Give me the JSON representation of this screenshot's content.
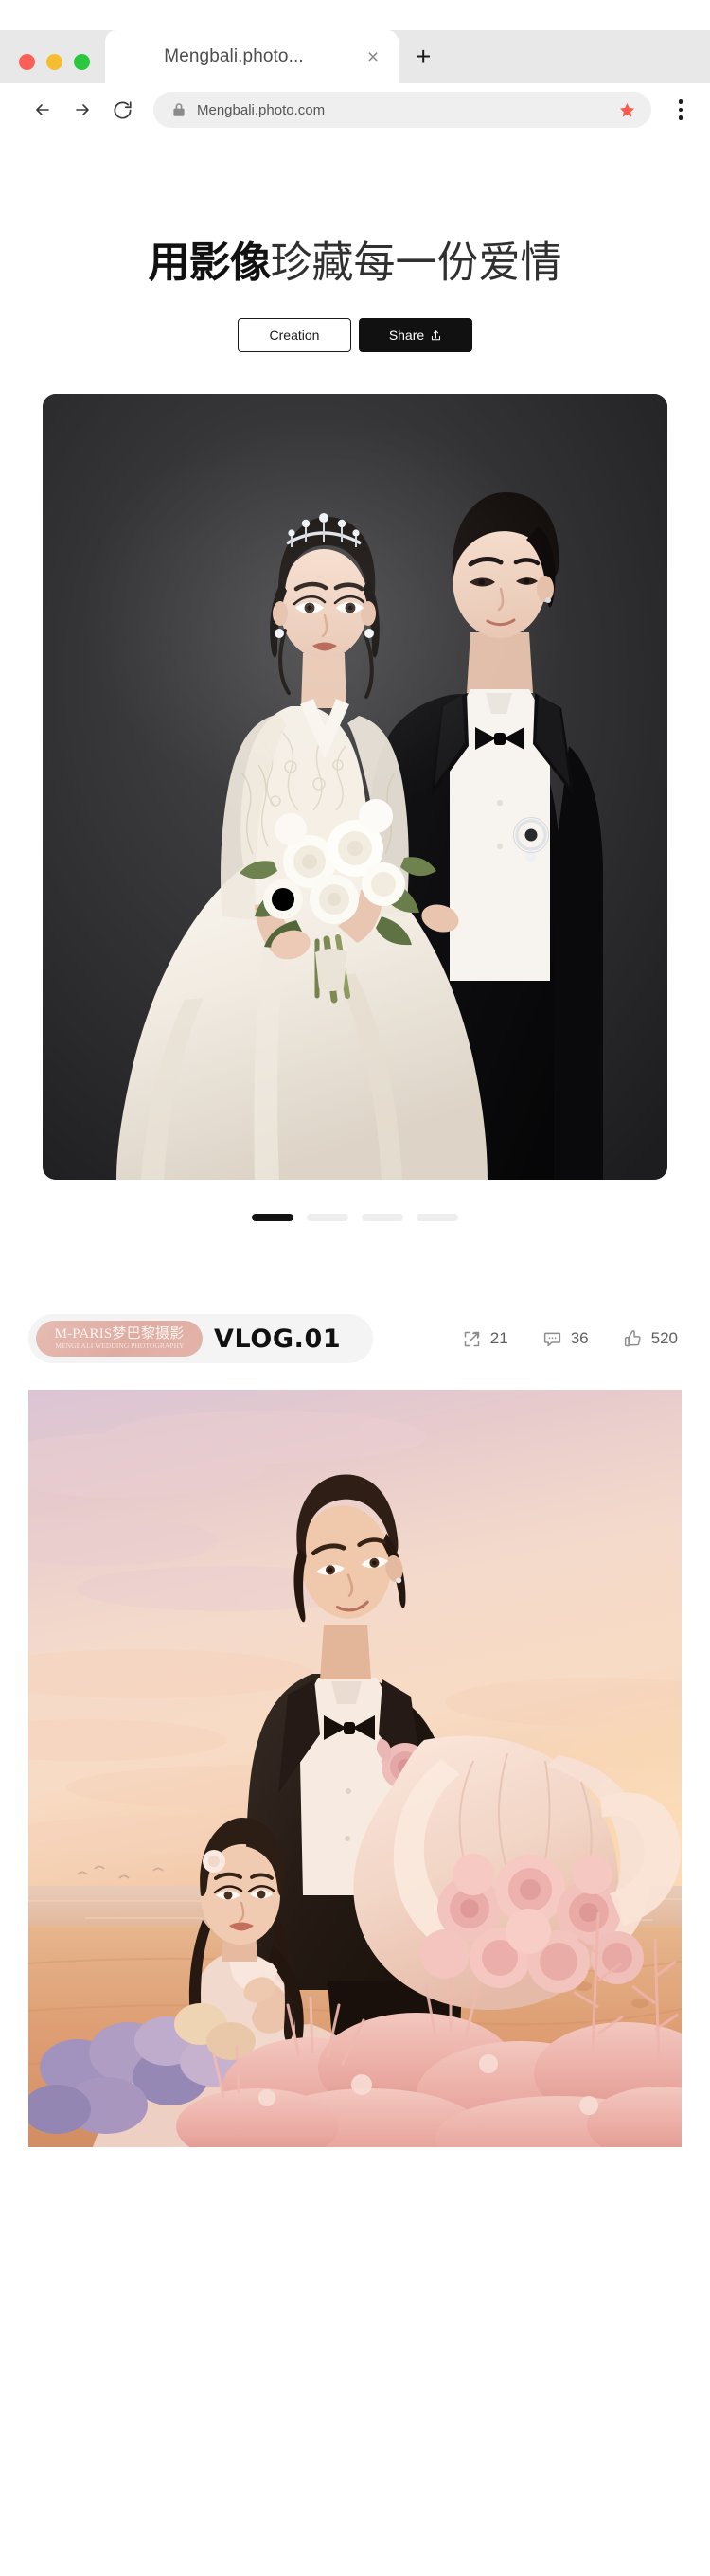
{
  "browser": {
    "tab": {
      "title": "Mengbali.photo...",
      "close_label": "×"
    },
    "new_tab_label": "+",
    "address_bar": {
      "url": "Mengbali.photo.com",
      "lock_icon": "lock-icon",
      "bookmark_icon": "star-icon"
    },
    "back_icon": "arrow-left-icon",
    "forward_icon": "arrow-right-icon",
    "reload_icon": "reload-icon",
    "menu_icon": "kebab-menu-icon",
    "traffic_lights": [
      "close-red",
      "minimize-yellow",
      "maximize-green"
    ],
    "colors": {
      "chrome_bg": "#e8e8e8",
      "tab_bg": "#ffffff",
      "url_field_bg": "#efefef",
      "red": "#fb5f57",
      "yellow": "#f6bd30",
      "green": "#29c83f",
      "bookmark": "#fb5a4f"
    }
  },
  "hero": {
    "title_bold": "用影像",
    "title_thin": "珍藏每一份爱情",
    "buttons": [
      {
        "label": "Creation",
        "style": "outline",
        "icon": ""
      },
      {
        "label": "Share",
        "style": "solid",
        "icon": "share-upload-icon"
      }
    ]
  },
  "carousel": {
    "slide_alt": "wedding-couple-studio-portrait",
    "dots": [
      {
        "active": true
      },
      {
        "active": false
      },
      {
        "active": false
      },
      {
        "active": false
      }
    ],
    "active_index": 1,
    "total": 4
  },
  "vlog": {
    "brand": {
      "main": "M-PARIS梦巴黎摄影",
      "sub": "MENGBALI WEDDING PHOTOGRAPHY",
      "color": "#dfaca2"
    },
    "label": "VLOG.01",
    "stats": [
      {
        "icon": "share-arrow-icon",
        "value": "21",
        "name": "share-count"
      },
      {
        "icon": "comment-bubble-icon",
        "value": "36",
        "name": "comment-count"
      },
      {
        "icon": "thumbs-up-icon",
        "value": "520",
        "name": "like-count"
      }
    ],
    "photo_alt": "beach-sunset-couple-with-pink-bouquet"
  }
}
